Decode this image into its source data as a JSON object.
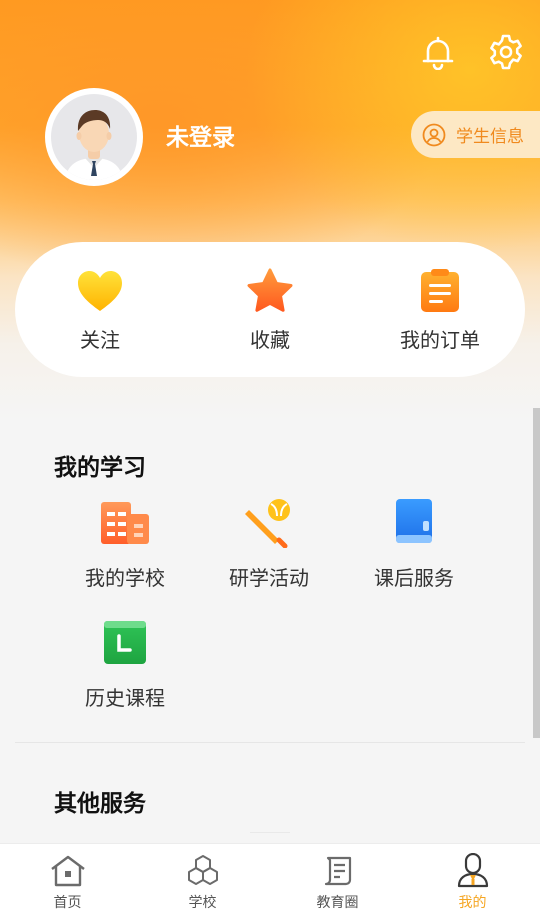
{
  "header": {
    "login_status": "未登录",
    "student_info_label": "学生信息",
    "icons": {
      "notifications": "bell-icon",
      "settings": "gear-icon",
      "student": "user-circle-icon"
    }
  },
  "quick_actions": [
    {
      "label": "关注",
      "icon": "heart-icon"
    },
    {
      "label": "收藏",
      "icon": "star-icon"
    },
    {
      "label": "我的订单",
      "icon": "order-icon"
    }
  ],
  "my_learning": {
    "title": "我的学习",
    "items": [
      {
        "label": "我的学校",
        "icon": "building-icon"
      },
      {
        "label": "研学活动",
        "icon": "sports-bat-icon"
      },
      {
        "label": "课后服务",
        "icon": "book-icon"
      },
      {
        "label": "历史课程",
        "icon": "clock-icon"
      }
    ]
  },
  "other_services": {
    "title": "其他服务"
  },
  "tabbar": {
    "active": "我的",
    "items": [
      {
        "label": "首页",
        "icon": "home-icon"
      },
      {
        "label": "学校",
        "icon": "cubes-icon"
      },
      {
        "label": "教育圈",
        "icon": "document-icon"
      },
      {
        "label": "我的",
        "icon": "profile-icon"
      }
    ]
  },
  "colors": {
    "accent": "#f5a623",
    "header_orange": "#ff9a20",
    "pill_text": "#f08a1e"
  }
}
